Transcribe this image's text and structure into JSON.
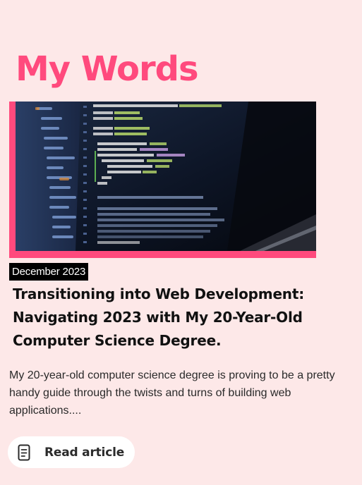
{
  "page": {
    "title": "My Words"
  },
  "post": {
    "date": "December 2023",
    "title": "Transitioning into Web Development: Navigating 2023 with My 20-Year-Old Computer Science Degree.",
    "excerpt": "My 20-year-old computer science degree is proving to be a pretty handy guide through the twists and turns of building web applications....",
    "cta_label": "Read article",
    "cta_icon": "document-icon"
  },
  "colors": {
    "background": "#fde8e8",
    "accent": "#ff4a7d",
    "date_badge_bg": "#000000",
    "button_bg": "#ffffff"
  }
}
